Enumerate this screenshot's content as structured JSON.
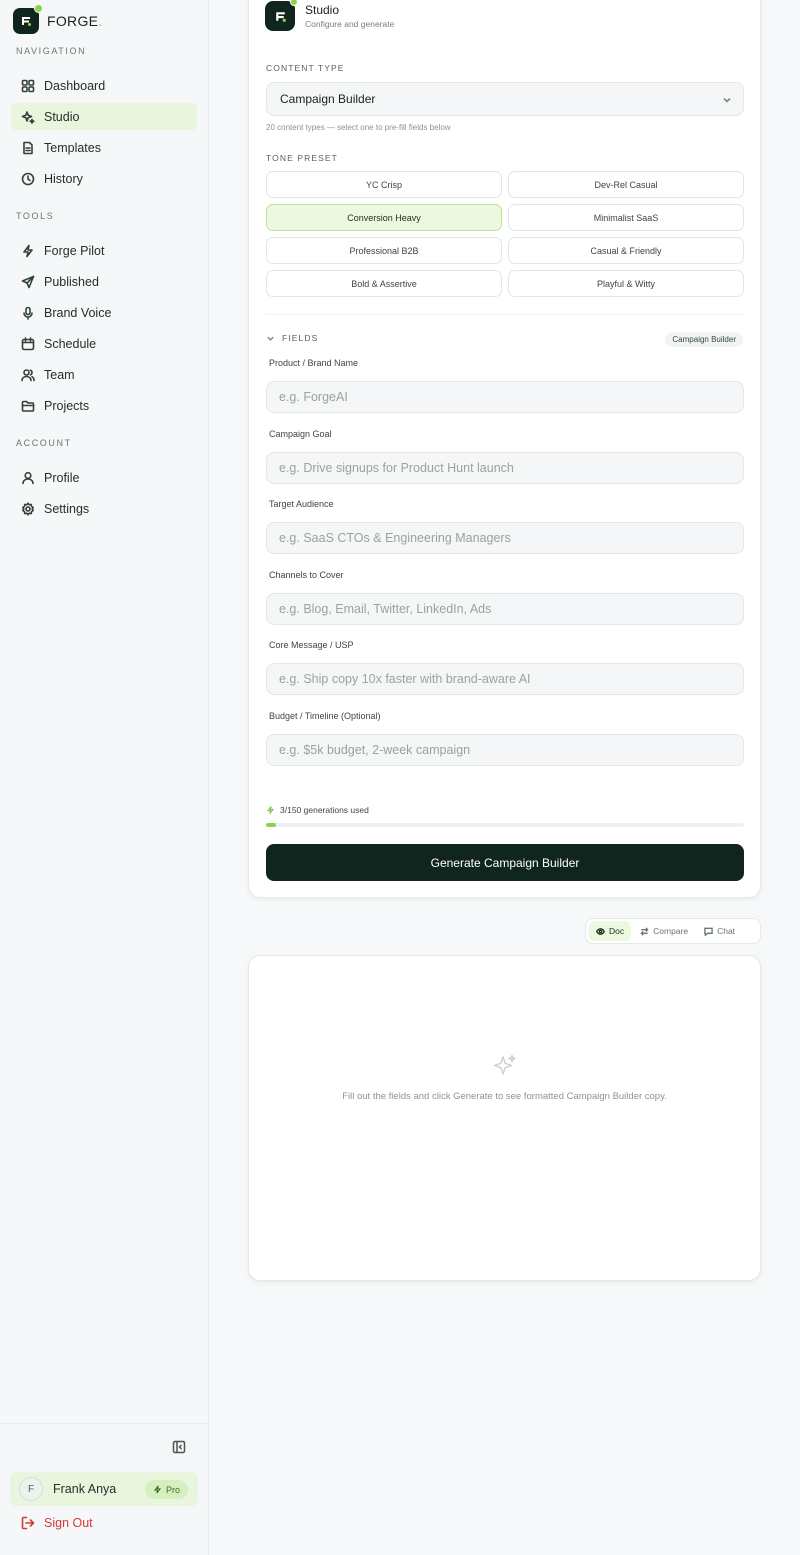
{
  "brand": {
    "name": "FORGE",
    "accent_dot": ".",
    "accent_color": "#8ad34a",
    "dark_color": "#10251d"
  },
  "sidebar": {
    "sections": [
      {
        "label": "NAVIGATION",
        "items": [
          {
            "label": "Dashboard",
            "icon": "grid-icon"
          },
          {
            "label": "Studio",
            "icon": "sparkles-icon",
            "active": true
          },
          {
            "label": "Templates",
            "icon": "file-icon"
          },
          {
            "label": "History",
            "icon": "clock-icon"
          }
        ]
      },
      {
        "label": "TOOLS",
        "items": [
          {
            "label": "Forge Pilot",
            "icon": "bolt-icon"
          },
          {
            "label": "Published",
            "icon": "send-icon"
          },
          {
            "label": "Brand Voice",
            "icon": "mic-icon"
          },
          {
            "label": "Schedule",
            "icon": "calendar-icon"
          },
          {
            "label": "Team",
            "icon": "users-icon"
          },
          {
            "label": "Projects",
            "icon": "folder-icon"
          }
        ]
      },
      {
        "label": "ACCOUNT",
        "items": [
          {
            "label": "Profile",
            "icon": "user-icon"
          },
          {
            "label": "Settings",
            "icon": "gear-icon"
          }
        ]
      }
    ],
    "user": {
      "initial": "F",
      "name": "Frank Anya",
      "plan": "Pro"
    },
    "sign_out": "Sign Out"
  },
  "studio": {
    "title": "Studio",
    "subtitle": "Configure and generate",
    "content_type_label": "CONTENT TYPE",
    "content_type_value": "Campaign Builder",
    "content_type_hint": "20 content types — select one to pre-fill fields below",
    "tone_label": "TONE PRESET",
    "tones": [
      "YC Crisp",
      "Dev-Rel Casual",
      "Conversion Heavy",
      "Minimalist SaaS",
      "Professional B2B",
      "Casual & Friendly",
      "Bold & Assertive",
      "Playful & Witty"
    ],
    "selected_tone": "Conversion Heavy",
    "fields_label": "FIELDS",
    "fields_chip": "Campaign Builder",
    "fields": [
      {
        "label": "Product / Brand Name",
        "placeholder": "e.g. ForgeAI"
      },
      {
        "label": "Campaign Goal",
        "placeholder": "e.g. Drive signups for Product Hunt launch"
      },
      {
        "label": "Target Audience",
        "placeholder": "e.g. SaaS CTOs & Engineering Managers"
      },
      {
        "label": "Channels to Cover",
        "placeholder": "e.g. Blog, Email, Twitter, LinkedIn, Ads"
      },
      {
        "label": "Core Message / USP",
        "placeholder": "e.g. Ship copy 10x faster with brand-aware AI"
      },
      {
        "label": "Budget / Timeline (Optional)",
        "placeholder": "e.g. $5k budget, 2-week campaign"
      }
    ],
    "usage_text": "3/150 generations used",
    "usage_fraction": 0.02,
    "generate_label": "Generate Campaign Builder"
  },
  "output": {
    "views": [
      {
        "label": "Doc",
        "icon": "eye-icon",
        "active": true
      },
      {
        "label": "Compare",
        "icon": "swap-icon"
      },
      {
        "label": "Chat",
        "icon": "chat-icon"
      }
    ],
    "empty_text": "Fill out the fields and click Generate to see formatted Campaign Builder copy."
  }
}
